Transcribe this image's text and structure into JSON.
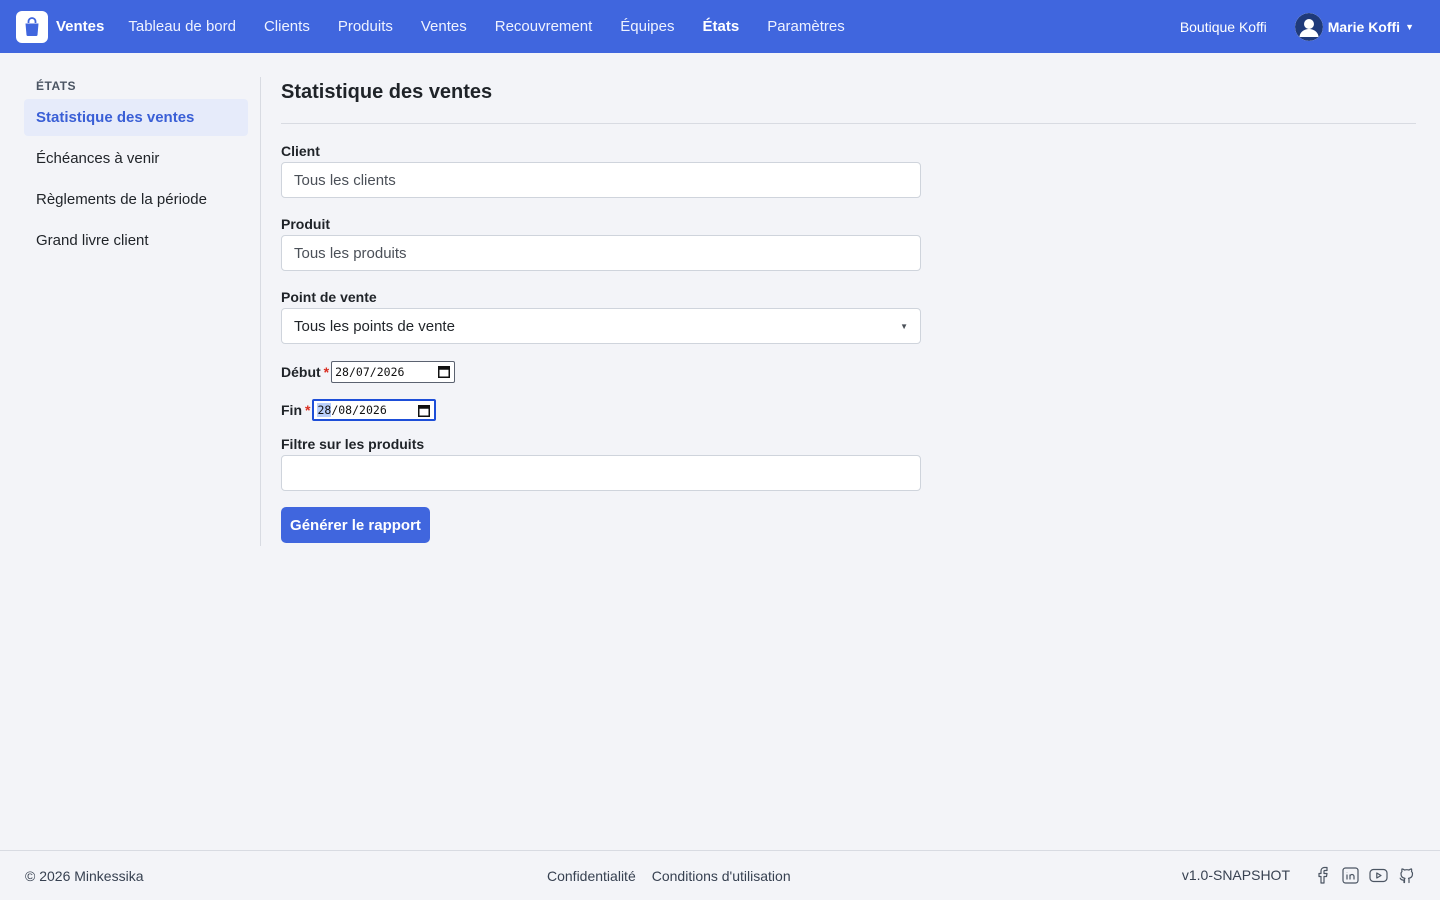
{
  "brand": {
    "name": "Ventes",
    "icon": "shopping-bag-icon"
  },
  "nav": {
    "items": [
      {
        "label": "Tableau de bord",
        "active": false
      },
      {
        "label": "Clients",
        "active": false
      },
      {
        "label": "Produits",
        "active": false
      },
      {
        "label": "Ventes",
        "active": false
      },
      {
        "label": "Recouvrement",
        "active": false
      },
      {
        "label": "Équipes",
        "active": false
      },
      {
        "label": "États",
        "active": true
      },
      {
        "label": "Paramètres",
        "active": false
      }
    ]
  },
  "header": {
    "shop": "Boutique Koffi",
    "user": "Marie Koffi"
  },
  "sidebar": {
    "title": "ÉTATS",
    "items": [
      {
        "label": "Statistique des ventes",
        "active": true
      },
      {
        "label": "Échéances à venir",
        "active": false
      },
      {
        "label": "Règlements de la période",
        "active": false
      },
      {
        "label": "Grand livre client",
        "active": false
      }
    ]
  },
  "main": {
    "title": "Statistique des ventes",
    "client": {
      "label": "Client",
      "placeholder": "Tous les clients"
    },
    "product": {
      "label": "Produit",
      "placeholder": "Tous les produits"
    },
    "pos": {
      "label": "Point de vente",
      "value": "Tous les points de vente"
    },
    "start": {
      "label": "Début",
      "required": "*",
      "day": "28",
      "month": "07",
      "year": "2026"
    },
    "end": {
      "label": "Fin",
      "required": "*",
      "day": "28",
      "month": "08",
      "year": "2026"
    },
    "filter": {
      "label": "Filtre sur les produits",
      "value": ""
    },
    "submit": "Générer le rapport"
  },
  "footer": {
    "copyright": "© 2026 Minkessika",
    "links": [
      "Confidentialité",
      "Conditions d'utilisation"
    ],
    "version": "v1.0-SNAPSHOT",
    "social": [
      "facebook-icon",
      "linkedin-icon",
      "youtube-icon",
      "github-icon"
    ]
  },
  "colors": {
    "primary": "#4066de",
    "sidebar_active_bg": "#e6ebfa",
    "required": "#d92d20"
  }
}
